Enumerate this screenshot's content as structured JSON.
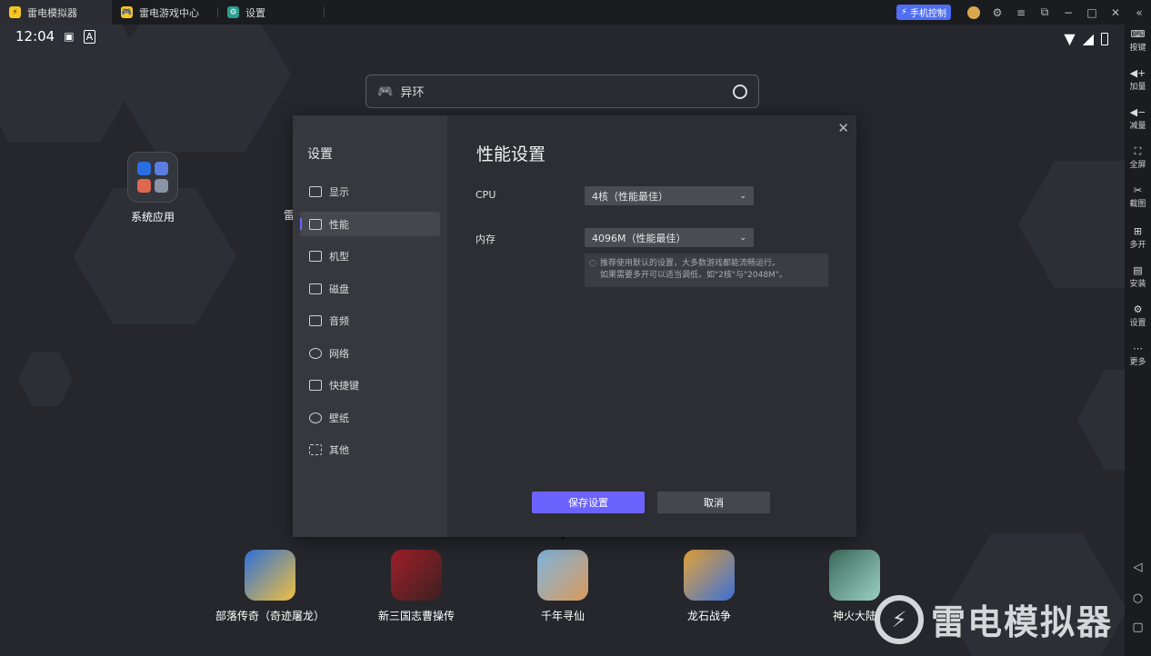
{
  "titlebar": {
    "tabs": [
      {
        "label": "雷电模拟器"
      },
      {
        "label": "雷电游戏中心"
      },
      {
        "label": "设置"
      }
    ],
    "phone_control": "手机控制"
  },
  "statusbar": {
    "time": "12:04"
  },
  "search": {
    "value": "异环"
  },
  "home": {
    "system_app": "系统应用",
    "partial_app": "雷",
    "games": [
      {
        "label": "部落传奇（奇迹屠龙）",
        "color": "#2f6fd6"
      },
      {
        "label": "新三国志曹操传",
        "color": "#a3202a"
      },
      {
        "label": "千年寻仙",
        "color": "#7fb6e0"
      },
      {
        "label": "龙石战争",
        "color": "#e6a53a"
      },
      {
        "label": "神火大陆",
        "color": "#3c6a5c"
      }
    ],
    "brand": "雷电模拟器"
  },
  "right_toolbar": [
    {
      "label": "按键",
      "icon": "keyboard-icon"
    },
    {
      "label": "加量",
      "icon": "volume-up-icon"
    },
    {
      "label": "减量",
      "icon": "volume-down-icon"
    },
    {
      "label": "全屏",
      "icon": "fullscreen-icon"
    },
    {
      "label": "截图",
      "icon": "scissors-icon"
    },
    {
      "label": "多开",
      "icon": "multi-instance-icon"
    },
    {
      "label": "安装",
      "icon": "install-icon"
    },
    {
      "label": "设置",
      "icon": "gear-icon"
    },
    {
      "label": "更多",
      "icon": "more-icon"
    }
  ],
  "settings": {
    "title": "设置",
    "nav": [
      {
        "label": "显示"
      },
      {
        "label": "性能"
      },
      {
        "label": "机型"
      },
      {
        "label": "磁盘"
      },
      {
        "label": "音频"
      },
      {
        "label": "网络"
      },
      {
        "label": "快捷键"
      },
      {
        "label": "壁纸"
      },
      {
        "label": "其他"
      }
    ],
    "active_nav": "性能",
    "page_title": "性能设置",
    "cpu_label": "CPU",
    "cpu_value": "4核（性能最佳）",
    "mem_label": "内存",
    "mem_value": "4096M（性能最佳）",
    "hint_line1": "推荐使用默认的设置，大多数游戏都能流畅运行。",
    "hint_line2": "如果需要多开可以适当调低，如\"2核\"与\"2048M\"。",
    "save": "保存设置",
    "cancel": "取消"
  },
  "colors": {
    "accent": "#6c63ff",
    "phone_control": "#4f6ef2"
  }
}
